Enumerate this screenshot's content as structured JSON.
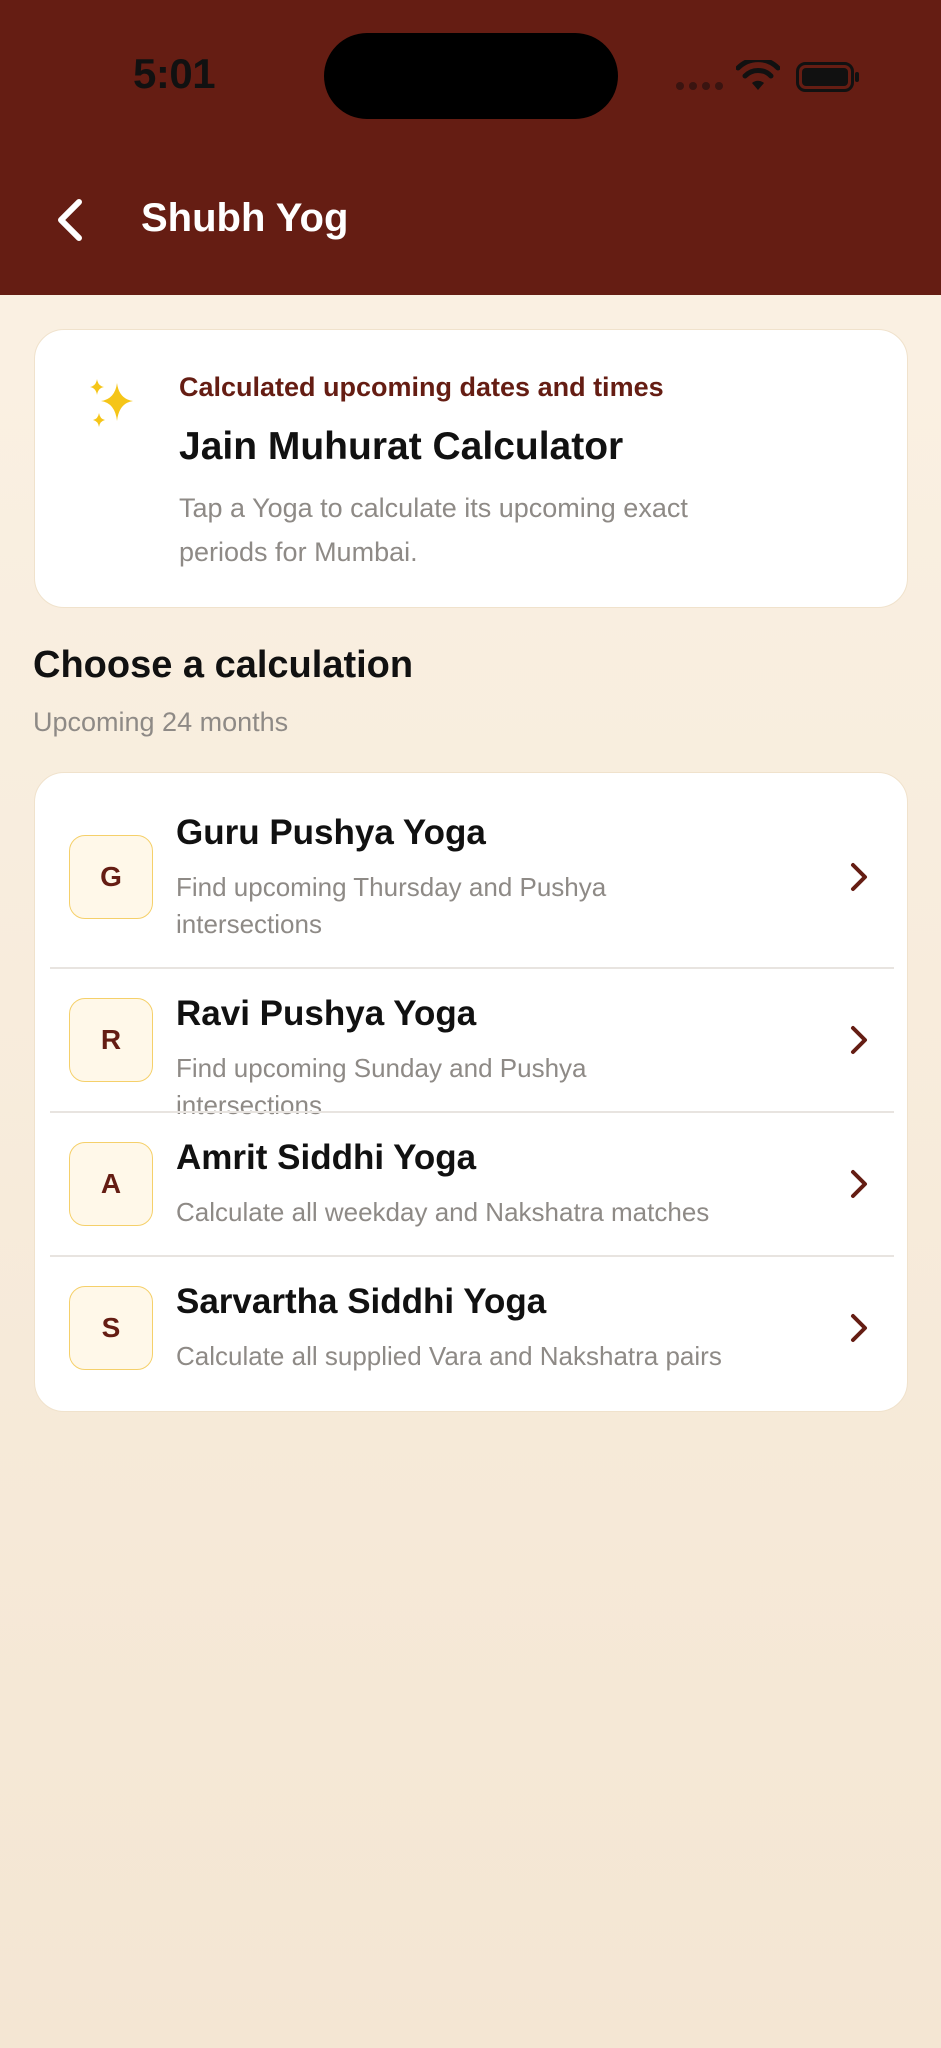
{
  "status_bar": {
    "time": "5:01"
  },
  "nav": {
    "title": "Shubh Yog"
  },
  "hero": {
    "icon": "sparkles-icon",
    "eyebrow": "Calculated upcoming dates and times",
    "title": "Jain Muhurat Calculator",
    "description": "Tap a Yoga to calculate its upcoming exact periods for Mumbai."
  },
  "section": {
    "title": "Choose a calculation",
    "subtitle": "Upcoming 24 months"
  },
  "items": [
    {
      "badge": "G",
      "title": "Guru Pushya Yoga",
      "description": "Find upcoming Thursday and Pushya intersections"
    },
    {
      "badge": "R",
      "title": "Ravi Pushya Yoga",
      "description": "Find upcoming Sunday and Pushya intersections"
    },
    {
      "badge": "A",
      "title": "Amrit Siddhi Yoga",
      "description": "Calculate all weekday and Nakshatra matches"
    },
    {
      "badge": "S",
      "title": "Sarvartha Siddhi Yoga",
      "description": "Calculate all supplied Vara and Nakshatra pairs"
    }
  ],
  "colors": {
    "header": "#651d13",
    "accent": "#651d13",
    "badge_border": "#f5d06a",
    "background": "#fbf2e5"
  }
}
